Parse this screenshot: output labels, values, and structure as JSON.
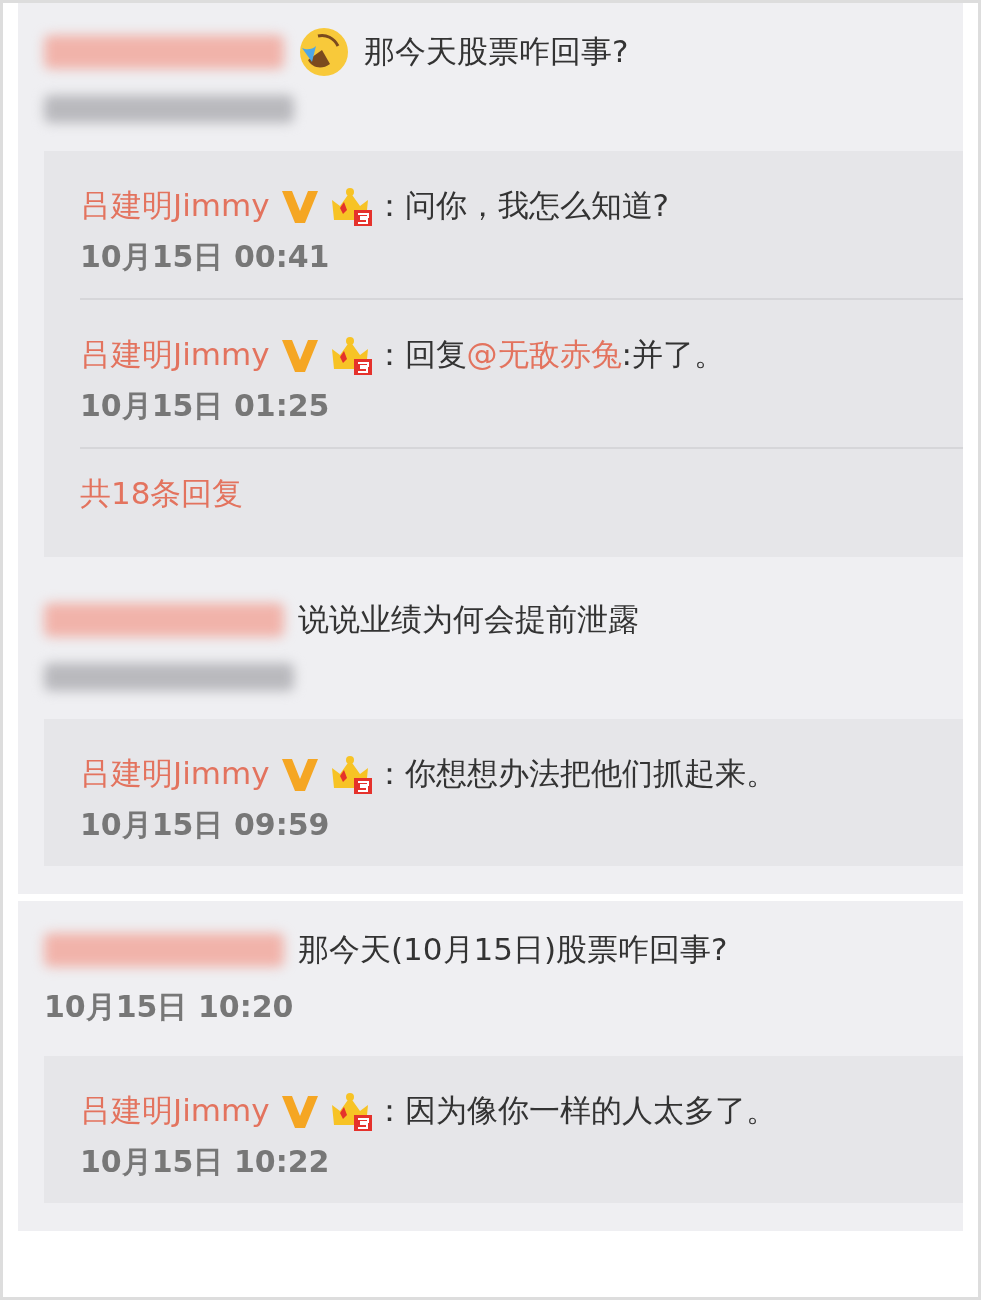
{
  "panels": [
    {
      "comments": [
        {
          "name_blurred": true,
          "emoji": true,
          "text": "那今天股票咋回事?",
          "replies": [
            {
              "author": "吕建明Jimmy",
              "verified": true,
              "level_badge": true,
              "segments": [
                {
                  "kind": "plain",
                  "text": "：问你，我怎么知道?"
                }
              ],
              "time": "10月15日 00:41"
            },
            {
              "author": "吕建明Jimmy",
              "verified": true,
              "level_badge": true,
              "segments": [
                {
                  "kind": "plain",
                  "text": "：回复"
                },
                {
                  "kind": "mention",
                  "text": "@无敌赤兔"
                },
                {
                  "kind": "plain",
                  "text": ":并了。"
                }
              ],
              "time": "10月15日 01:25"
            }
          ],
          "more_link": "共18条回复"
        },
        {
          "name_blurred": true,
          "emoji": false,
          "text": "说说业绩为何会提前泄露",
          "replies": [
            {
              "author": "吕建明Jimmy",
              "verified": true,
              "level_badge": true,
              "segments": [
                {
                  "kind": "plain",
                  "text": "：你想想办法把他们抓起来。"
                }
              ],
              "time": "10月15日 09:59"
            }
          ]
        }
      ]
    },
    {
      "comments": [
        {
          "name_blurred": true,
          "emoji": false,
          "text": "那今天(10月15日)股票咋回事?",
          "time": "10月15日 10:20",
          "replies": [
            {
              "author": "吕建明Jimmy",
              "verified": true,
              "level_badge": true,
              "segments": [
                {
                  "kind": "plain",
                  "text": "：因为像你一样的人太多了。"
                }
              ],
              "time": "10月15日 10:22"
            }
          ]
        }
      ]
    }
  ]
}
